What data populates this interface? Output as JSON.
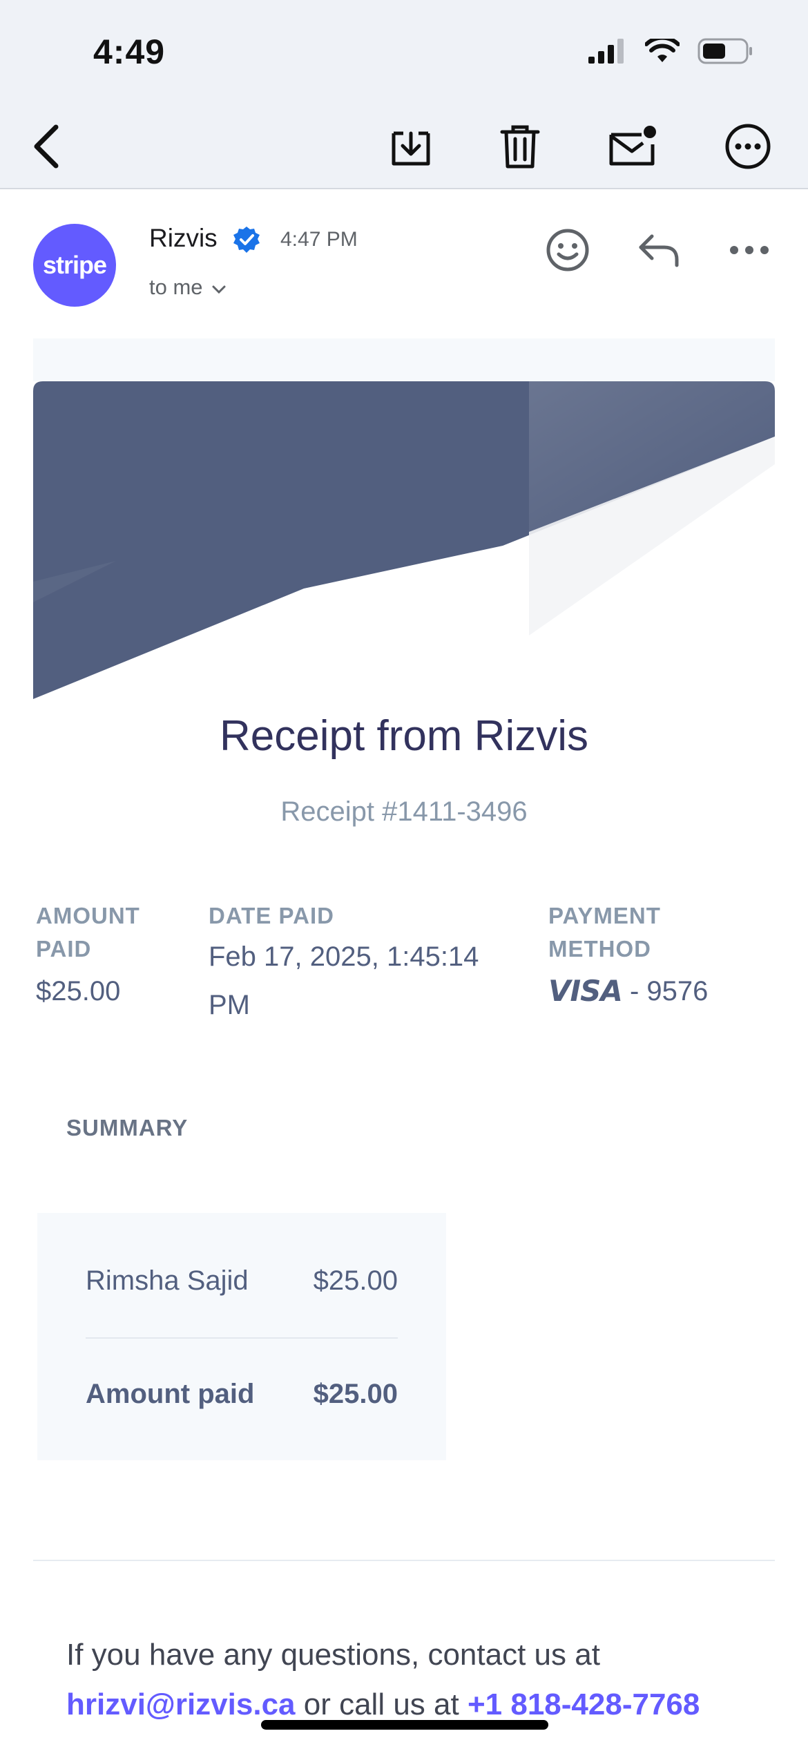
{
  "status_bar": {
    "time": "4:49",
    "icons": [
      "signal-icon",
      "wifi-icon",
      "battery-icon"
    ]
  },
  "toolbar": {
    "icons": [
      "back-arrow-icon",
      "move-to-inbox-icon",
      "trash-icon",
      "mark-unread-icon",
      "more-options-icon"
    ]
  },
  "message": {
    "avatar_text": "stripe",
    "sender": "Rizvis",
    "time": "4:47 PM",
    "recipient": "to me",
    "actions": [
      "emoji-reaction-icon",
      "reply-icon",
      "more-icon"
    ]
  },
  "receipt": {
    "title": "Receipt from Rizvis",
    "number": "Receipt #1411-3496",
    "amount_paid_label_1": "AMOUNT",
    "amount_paid_label_2": "PAID",
    "amount_paid_value": "$25.00",
    "date_paid_label": "DATE PAID",
    "date_paid_value_1": "Feb 17, 2025, 1:45:14",
    "date_paid_value_2": "PM",
    "payment_method_label_1": "PAYMENT",
    "payment_method_label_2": "METHOD",
    "card_brand": "VISA",
    "card_last4": "- 9576"
  },
  "summary": {
    "heading": "SUMMARY",
    "items": [
      {
        "name": "Rimsha Sajid",
        "amount": "$25.00"
      }
    ],
    "total_label": "Amount paid",
    "total_value": "$25.00"
  },
  "footer": {
    "text_1": "If you have any questions, contact us at",
    "email": "hrizvi@rizvis.ca",
    "text_2": " or call us at ",
    "phone": "+1 818-428-7768",
    "colors": {
      "link": "#635bff",
      "text": "#414552"
    }
  },
  "colors": {
    "brand": "#635bff",
    "banner": "#525f7f",
    "title": "#32325d",
    "muted": "#8898aa"
  }
}
